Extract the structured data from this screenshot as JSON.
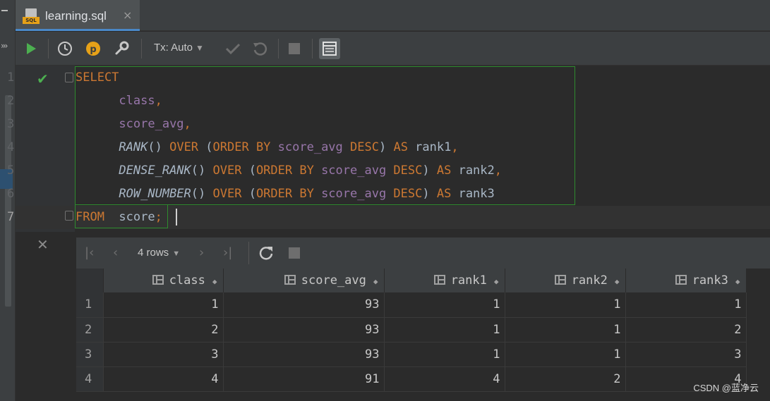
{
  "tab": {
    "title": "learning.sql",
    "icon_badge": "SQL",
    "close": "×"
  },
  "toolbar": {
    "tx_mode": "Tx: Auto",
    "p_badge": "p"
  },
  "editor": {
    "line_numbers": [
      "1",
      "2",
      "3",
      "4",
      "5",
      "6",
      "7"
    ],
    "lines": [
      [
        {
          "t": "kw",
          "v": "SELECT"
        }
      ],
      [
        {
          "t": "txt",
          "v": "      "
        },
        {
          "t": "col",
          "v": "class"
        },
        {
          "t": "kw",
          "v": ","
        }
      ],
      [
        {
          "t": "txt",
          "v": "      "
        },
        {
          "t": "col",
          "v": "score_avg"
        },
        {
          "t": "kw",
          "v": ","
        }
      ],
      [
        {
          "t": "txt",
          "v": "      "
        },
        {
          "t": "fn",
          "v": "RANK"
        },
        {
          "t": "txt",
          "v": "() "
        },
        {
          "t": "kw",
          "v": "OVER"
        },
        {
          "t": "txt",
          "v": " ("
        },
        {
          "t": "kw",
          "v": "ORDER BY "
        },
        {
          "t": "col",
          "v": "score_avg"
        },
        {
          "t": "kw",
          "v": " DESC"
        },
        {
          "t": "txt",
          "v": ") "
        },
        {
          "t": "kw",
          "v": "AS"
        },
        {
          "t": "txt",
          "v": " rank1"
        },
        {
          "t": "kw",
          "v": ","
        }
      ],
      [
        {
          "t": "txt",
          "v": "      "
        },
        {
          "t": "fn",
          "v": "DENSE_RANK"
        },
        {
          "t": "txt",
          "v": "() "
        },
        {
          "t": "kw",
          "v": "OVER"
        },
        {
          "t": "txt",
          "v": " ("
        },
        {
          "t": "kw",
          "v": "ORDER BY "
        },
        {
          "t": "col",
          "v": "score_avg"
        },
        {
          "t": "kw",
          "v": " DESC"
        },
        {
          "t": "txt",
          "v": ") "
        },
        {
          "t": "kw",
          "v": "AS"
        },
        {
          "t": "txt",
          "v": " rank2"
        },
        {
          "t": "kw",
          "v": ","
        }
      ],
      [
        {
          "t": "txt",
          "v": "      "
        },
        {
          "t": "fn",
          "v": "ROW_NUMBER"
        },
        {
          "t": "txt",
          "v": "() "
        },
        {
          "t": "kw",
          "v": "OVER"
        },
        {
          "t": "txt",
          "v": " ("
        },
        {
          "t": "kw",
          "v": "ORDER BY "
        },
        {
          "t": "col",
          "v": "score_avg"
        },
        {
          "t": "kw",
          "v": " DESC"
        },
        {
          "t": "txt",
          "v": ") "
        },
        {
          "t": "kw",
          "v": "AS"
        },
        {
          "t": "txt",
          "v": " rank3"
        }
      ],
      [
        {
          "t": "kw",
          "v": "FROM"
        },
        {
          "t": "txt",
          "v": "  score"
        },
        {
          "t": "kw",
          "v": ";"
        }
      ]
    ]
  },
  "results": {
    "rows_label": "4 rows",
    "columns": [
      "class",
      "score_avg",
      "rank1",
      "rank2",
      "rank3"
    ],
    "rows": [
      {
        "n": "1",
        "cells": [
          "1",
          "93",
          "1",
          "1",
          "1"
        ]
      },
      {
        "n": "2",
        "cells": [
          "2",
          "93",
          "1",
          "1",
          "2"
        ]
      },
      {
        "n": "3",
        "cells": [
          "3",
          "93",
          "1",
          "1",
          "3"
        ]
      },
      {
        "n": "4",
        "cells": [
          "4",
          "91",
          "4",
          "2",
          "4"
        ]
      }
    ]
  },
  "watermark": "CSDN @蓝净云",
  "colors": {
    "keyword": "#cc7832",
    "column": "#9876aa",
    "accent": "#4a88c7",
    "run": "#4caf50"
  }
}
